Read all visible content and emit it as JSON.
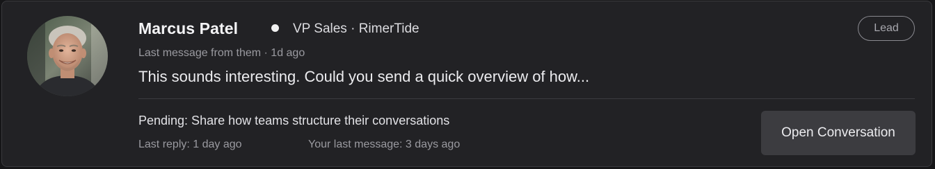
{
  "contact": {
    "name": "Marcus Patel",
    "role_company": "VP Sales · RimerTide",
    "badge": "Lead"
  },
  "last_message": {
    "meta": "Last message from them · 1d ago",
    "preview": "This sounds interesting. Could you send a quick overview of how..."
  },
  "pending": {
    "text": "Pending: Share how teams structure their conversations"
  },
  "activity": {
    "last_reply": "Last reply: 1 day ago",
    "your_last_message": "Your last message: 3 days ago"
  },
  "actions": {
    "open_label": "Open Conversation"
  },
  "colors": {
    "card_background": "#222225",
    "button_background": "#3c3c40",
    "status_dot": "#f2f2f2"
  }
}
